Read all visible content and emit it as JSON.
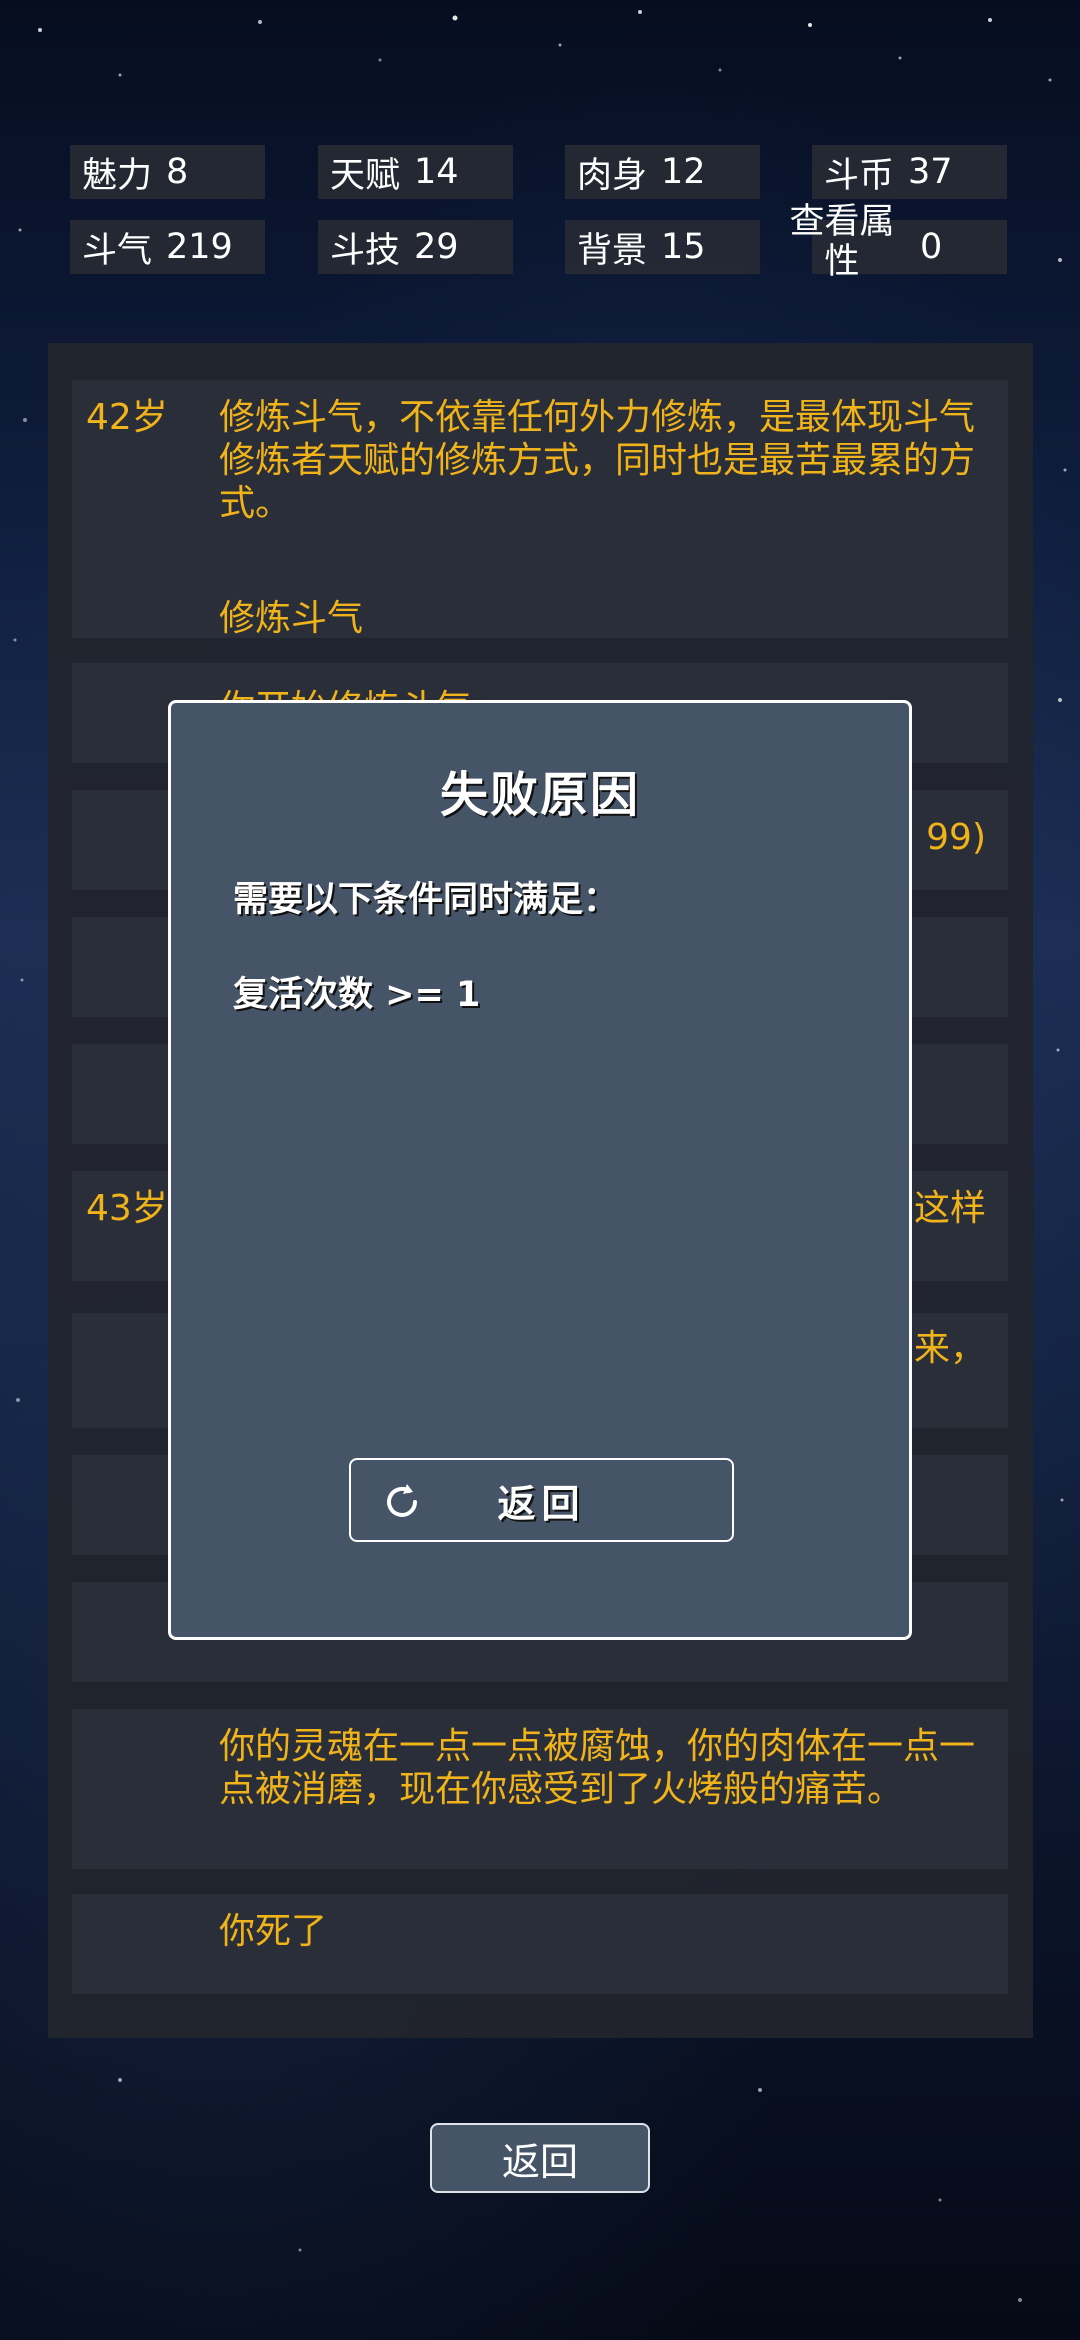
{
  "stats": [
    {
      "label": "魅力",
      "value": "8"
    },
    {
      "label": "天赋",
      "value": "14"
    },
    {
      "label": "肉身",
      "value": "12"
    },
    {
      "label": "斗币",
      "value": "37"
    },
    {
      "label": "斗气",
      "value": "219"
    },
    {
      "label": "斗技",
      "value": "29"
    },
    {
      "label": "背景",
      "value": "15"
    },
    {
      "label": "查看属性",
      "value": "0"
    }
  ],
  "log": {
    "entry1": {
      "age": "42岁",
      "text": "修炼斗气，不依靠任何外力修炼，是最体现斗气修炼者天赋的修炼方式，同时也是最苦最累的方式。",
      "sub": "修炼斗气"
    },
    "entry2": {
      "text": "你开始修炼斗气"
    },
    "entry3": {
      "tail": "99)"
    },
    "entry6": {
      "age": "43岁",
      "tail": "这样"
    },
    "entry7": {
      "tail": "来，"
    },
    "entry11": {
      "text": "你的灵魂在一点一点被腐蚀，你的肉体在一点一点被消磨，现在你感受到了火烤般的痛苦。"
    },
    "entry12": {
      "text": "你死了"
    }
  },
  "modal": {
    "title": "失败原因",
    "line1": "需要以下条件同时满足：",
    "line2": "复活次数 >= 1",
    "button_label": "返回",
    "button_icon": "refresh-icon"
  },
  "bottom_button": {
    "label": "返回"
  }
}
